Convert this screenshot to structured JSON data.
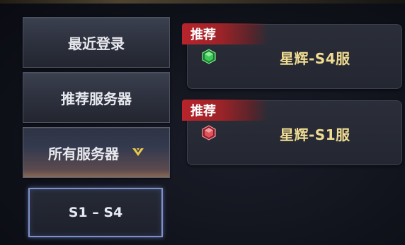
{
  "sidebar": {
    "recent_label": "最近登录",
    "recommended_label": "推荐服务器",
    "all_label": "所有服务器",
    "range_label": "S1 – S4"
  },
  "servers": [
    {
      "tag": "推荐",
      "name": "星辉-S4服",
      "status_color": "#3dcb55"
    },
    {
      "tag": "推荐",
      "name": "星辉-S1服",
      "status_color": "#e0535d"
    }
  ],
  "colors": {
    "accent_gold": "#f0dc92",
    "tag_red": "#b8242b",
    "selected_border": "#7f90c8"
  }
}
